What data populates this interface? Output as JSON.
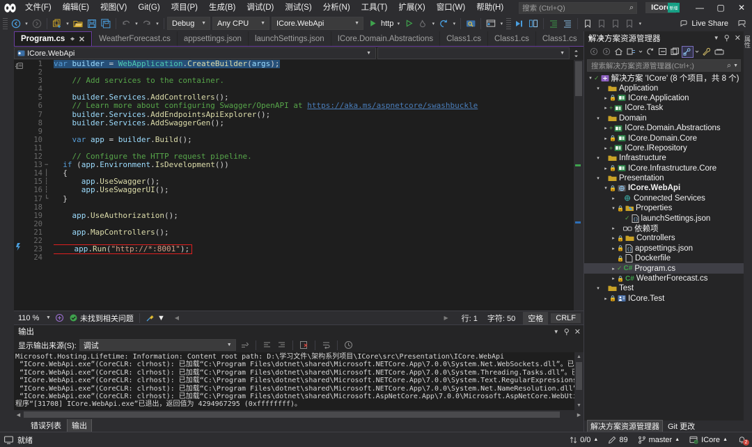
{
  "titlebar": {
    "menus": [
      "文件(F)",
      "编辑(E)",
      "视图(V)",
      "Git(G)",
      "项目(P)",
      "生成(B)",
      "调试(D)",
      "测试(S)",
      "分析(N)",
      "工具(T)",
      "扩展(X)",
      "窗口(W)",
      "帮助(H)"
    ],
    "search_placeholder": "搜索 (Ctrl+Q)",
    "solution_badge": "ICore",
    "minimize": "—",
    "maximize": "▢",
    "close": "✕",
    "accent_color": "#6b3fa0",
    "badge_color": "#16a085"
  },
  "toolbar": {
    "config": "Debug",
    "platform": "Any CPU",
    "startup_project": "ICore.WebApi",
    "run_label": "http",
    "live_share": "Live Share"
  },
  "tabs": [
    {
      "label": "Program.cs",
      "active": true,
      "pin": "⌖",
      "close": "✕"
    },
    {
      "label": "WeatherForecast.cs",
      "active": false
    },
    {
      "label": "appsettings.json",
      "active": false
    },
    {
      "label": "launchSettings.json",
      "active": false
    },
    {
      "label": "ICore.Domain.Abstractions",
      "active": false
    },
    {
      "label": "Class1.cs",
      "active": false
    },
    {
      "label": "Class1.cs",
      "active": false
    },
    {
      "label": "Class1.cs",
      "active": false
    }
  ],
  "navbar": {
    "project": "ICore.WebApi",
    "member": ""
  },
  "editor": {
    "lines": [
      {
        "n": 1,
        "fold": "",
        "tokens": [
          [
            "k",
            "var"
          ],
          [
            "p",
            " "
          ],
          [
            "v",
            "builder"
          ],
          [
            "p",
            " = "
          ],
          [
            "t",
            "WebApplication"
          ],
          [
            "p",
            "."
          ],
          [
            "m",
            "CreateBuilder"
          ],
          [
            "p",
            "("
          ],
          [
            "v",
            "args"
          ],
          [
            "p",
            ");"
          ]
        ]
      },
      {
        "n": 2,
        "fold": "",
        "tokens": []
      },
      {
        "n": 3,
        "fold": "",
        "tokens": [
          [
            "c",
            "    // Add services to the container."
          ]
        ]
      },
      {
        "n": 4,
        "fold": "",
        "tokens": []
      },
      {
        "n": 5,
        "fold": "",
        "tokens": [
          [
            "v",
            "    builder"
          ],
          [
            "p",
            "."
          ],
          [
            "v",
            "Services"
          ],
          [
            "p",
            "."
          ],
          [
            "m",
            "AddControllers"
          ],
          [
            "p",
            "();"
          ]
        ]
      },
      {
        "n": 6,
        "fold": "",
        "tokens": [
          [
            "c",
            "    // Learn more about configuring Swagger/OpenAPI at "
          ],
          [
            "lnk",
            "https://aka.ms/aspnetcore/swashbuckle"
          ]
        ]
      },
      {
        "n": 7,
        "fold": "",
        "tokens": [
          [
            "v",
            "    builder"
          ],
          [
            "p",
            "."
          ],
          [
            "v",
            "Services"
          ],
          [
            "p",
            "."
          ],
          [
            "m",
            "AddEndpointsApiExplorer"
          ],
          [
            "p",
            "();"
          ]
        ]
      },
      {
        "n": 8,
        "fold": "",
        "tokens": [
          [
            "v",
            "    builder"
          ],
          [
            "p",
            "."
          ],
          [
            "v",
            "Services"
          ],
          [
            "p",
            "."
          ],
          [
            "m",
            "AddSwaggerGen"
          ],
          [
            "p",
            "();"
          ]
        ]
      },
      {
        "n": 9,
        "fold": "",
        "tokens": []
      },
      {
        "n": 10,
        "fold": "",
        "tokens": [
          [
            "k",
            "    var"
          ],
          [
            "p",
            " "
          ],
          [
            "v",
            "app"
          ],
          [
            "p",
            " = "
          ],
          [
            "v",
            "builder"
          ],
          [
            "p",
            "."
          ],
          [
            "m",
            "Build"
          ],
          [
            "p",
            "();"
          ]
        ]
      },
      {
        "n": 11,
        "fold": "",
        "tokens": []
      },
      {
        "n": 12,
        "fold": "",
        "tokens": [
          [
            "c",
            "    // Configure the HTTP request pipeline."
          ]
        ]
      },
      {
        "n": 13,
        "fold": "−",
        "tokens": [
          [
            "k",
            "  if"
          ],
          [
            "p",
            " ("
          ],
          [
            "v",
            "app"
          ],
          [
            "p",
            "."
          ],
          [
            "v",
            "Environment"
          ],
          [
            "p",
            "."
          ],
          [
            "m",
            "IsDevelopment"
          ],
          [
            "p",
            "())"
          ]
        ]
      },
      {
        "n": 14,
        "fold": "│",
        "tokens": [
          [
            "p",
            "  {"
          ]
        ]
      },
      {
        "n": 15,
        "fold": "┆",
        "tokens": [
          [
            "v",
            "      app"
          ],
          [
            "p",
            "."
          ],
          [
            "m",
            "UseSwagger"
          ],
          [
            "p",
            "();"
          ]
        ]
      },
      {
        "n": 16,
        "fold": "┆",
        "tokens": [
          [
            "v",
            "      app"
          ],
          [
            "p",
            "."
          ],
          [
            "m",
            "UseSwaggerUI"
          ],
          [
            "p",
            "();"
          ]
        ]
      },
      {
        "n": 17,
        "fold": "└",
        "tokens": [
          [
            "p",
            "  }"
          ]
        ]
      },
      {
        "n": 18,
        "fold": "",
        "tokens": []
      },
      {
        "n": 19,
        "fold": "",
        "tokens": [
          [
            "v",
            "    app"
          ],
          [
            "p",
            "."
          ],
          [
            "m",
            "UseAuthorization"
          ],
          [
            "p",
            "();"
          ]
        ]
      },
      {
        "n": 20,
        "fold": "",
        "tokens": []
      },
      {
        "n": 21,
        "fold": "",
        "tokens": [
          [
            "v",
            "    app"
          ],
          [
            "p",
            "."
          ],
          [
            "m",
            "MapControllers"
          ],
          [
            "p",
            "();"
          ]
        ]
      },
      {
        "n": 22,
        "fold": "",
        "tokens": []
      },
      {
        "n": 23,
        "fold": "",
        "highlight": true,
        "tokens": [
          [
            "v",
            "    app"
          ],
          [
            "p",
            "."
          ],
          [
            "m",
            "Run"
          ],
          [
            "p",
            "("
          ],
          [
            "s",
            "\"http://*:8001\""
          ],
          [
            "p",
            ");"
          ]
        ]
      },
      {
        "n": 24,
        "fold": "",
        "tokens": []
      }
    ]
  },
  "editor_status": {
    "zoom": "110 %",
    "issues": "未找到相关问题",
    "line_label": "行: 1",
    "char_label": "字符: 50",
    "indent": "空格",
    "eol": "CRLF"
  },
  "output": {
    "title": "输出",
    "source_label": "显示输出来源(S):",
    "source_value": "调试",
    "lines": [
      "Microsoft.Hosting.Lifetime: Information: Content root path: D:\\学习文件\\架构系列项目\\ICore\\src\\Presentation\\ICore.WebApi",
      " “ICore.WebApi.exe”(CoreCLR: clrhost): 已加载“C:\\Program Files\\dotnet\\shared\\Microsoft.NETCore.App\\7.0.0\\System.Net.WebSockets.dll”。已跳过加载符号。模块进行了优化，并且调试器选项“仅我的代",
      " “ICore.WebApi.exe”(CoreCLR: clrhost): 已加载“C:\\Program Files\\dotnet\\shared\\Microsoft.NETCore.App\\7.0.0\\System.Threading.Tasks.dll”。已跳过加载符号。模块进行了优化，并且调试器选项“仅我的f",
      " “ICore.WebApi.exe”(CoreCLR: clrhost): 已加载“C:\\Program Files\\dotnet\\shared\\Microsoft.NETCore.App\\7.0.0\\System.Text.RegularExpressions.dll”。已跳过加载符号。模块进行了优化，并且调试器选项",
      " “ICore.WebApi.exe”(CoreCLR: clrhost): 已加载“C:\\Program Files\\dotnet\\shared\\Microsoft.NETCore.App\\7.0.0\\System.Net.NameResolution.dll”。已跳过加载符号。模块进行了优化，并且调试器选项“仅我",
      " “ICore.WebApi.exe”(CoreCLR: clrhost): 已加载“C:\\Program Files\\dotnet\\shared\\Microsoft.AspNetCore.App\\7.0.0\\Microsoft.AspNetCore.WebUtilities.dll”。已跳过加载符号。模块进行了优化，并且调试",
      "程序“[31708] ICore.WebApi.exe”已退出，返回值为 4294967295 (0xffffffff)。"
    ],
    "tabs": [
      {
        "label": "错误列表",
        "active": false
      },
      {
        "label": "输出",
        "active": true
      }
    ]
  },
  "solution_explorer": {
    "title": "解决方案资源管理器",
    "search_placeholder": "搜索解决方案资源管理器(Ctrl+;)",
    "vertical_dock_label": "属性",
    "tree": [
      {
        "indent": 0,
        "exp": "▾",
        "icon": "solution",
        "mark": "check",
        "label": "解决方案 'ICore' (8 个项目，共 8 个)"
      },
      {
        "indent": 1,
        "exp": "▾",
        "icon": "folder",
        "mark": "",
        "label": "Application"
      },
      {
        "indent": 2,
        "exp": "▸",
        "icon": "project",
        "mark": "lock",
        "label": "ICore.Application"
      },
      {
        "indent": 2,
        "exp": "▸",
        "icon": "project",
        "mark": "plus",
        "label": "ICore.Task"
      },
      {
        "indent": 1,
        "exp": "▾",
        "icon": "folder",
        "mark": "",
        "label": "Domain"
      },
      {
        "indent": 2,
        "exp": "▸",
        "icon": "project",
        "mark": "plus",
        "label": "ICore.Domain.Abstractions"
      },
      {
        "indent": 2,
        "exp": "▸",
        "icon": "project",
        "mark": "lock",
        "label": "ICore.Domain.Core"
      },
      {
        "indent": 2,
        "exp": "▸",
        "icon": "project",
        "mark": "plus",
        "label": "ICore.IRepository"
      },
      {
        "indent": 1,
        "exp": "▾",
        "icon": "folder",
        "mark": "",
        "label": "Infrastructure"
      },
      {
        "indent": 2,
        "exp": "▸",
        "icon": "project",
        "mark": "lock",
        "label": "ICore.Infrastructure.Core"
      },
      {
        "indent": 1,
        "exp": "▾",
        "icon": "folder",
        "mark": "",
        "label": "Presentation"
      },
      {
        "indent": 2,
        "exp": "▾",
        "icon": "webproj",
        "mark": "lock",
        "label": "ICore.WebApi",
        "bold": true
      },
      {
        "indent": 3,
        "exp": "▸",
        "icon": "services",
        "mark": "",
        "label": "Connected Services"
      },
      {
        "indent": 3,
        "exp": "▾",
        "icon": "props",
        "mark": "lock",
        "label": "Properties"
      },
      {
        "indent": 4,
        "exp": "",
        "icon": "json",
        "mark": "check",
        "label": "launchSettings.json"
      },
      {
        "indent": 3,
        "exp": "▸",
        "icon": "deps",
        "mark": "",
        "label": "依赖项"
      },
      {
        "indent": 3,
        "exp": "▸",
        "icon": "folder",
        "mark": "lock",
        "label": "Controllers"
      },
      {
        "indent": 3,
        "exp": "▸",
        "icon": "json",
        "mark": "lock",
        "label": "appsettings.json"
      },
      {
        "indent": 3,
        "exp": "",
        "icon": "file",
        "mark": "lock",
        "label": "Dockerfile"
      },
      {
        "indent": 3,
        "exp": "▸",
        "icon": "cs",
        "mark": "check",
        "label": "Program.cs",
        "selected": true
      },
      {
        "indent": 3,
        "exp": "▸",
        "icon": "cs",
        "mark": "lock",
        "label": "WeatherForecast.cs"
      },
      {
        "indent": 1,
        "exp": "▾",
        "icon": "folder",
        "mark": "",
        "label": "Test"
      },
      {
        "indent": 2,
        "exp": "▸",
        "icon": "testproj",
        "mark": "lock",
        "label": "ICore.Test"
      }
    ],
    "bottom_tabs": [
      {
        "label": "解决方案资源管理器",
        "active": true
      },
      {
        "label": "Git 更改",
        "active": false
      }
    ]
  },
  "statusbar": {
    "state": "就绪",
    "sync": "0/0",
    "pending_edits": "89",
    "branch": "master",
    "repo": "ICore",
    "notifications": "2"
  }
}
